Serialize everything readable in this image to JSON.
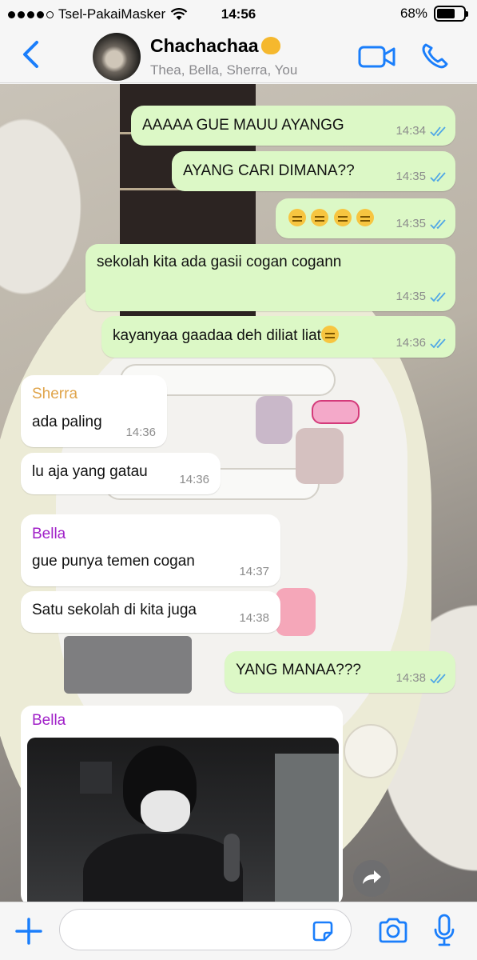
{
  "status_bar": {
    "carrier": "Tsel-PakaiMasker",
    "time": "14:56",
    "battery": "68%",
    "battery_level": 0.68
  },
  "header": {
    "title": "Chachachaa",
    "title_emoji": "cat-face-emoji",
    "members": "Thea, Bella, Sherra, You"
  },
  "messages": [
    {
      "dir": "out",
      "text": "AAAAA GUE MAUU AYANGG",
      "time": "14:34",
      "read": true
    },
    {
      "dir": "out",
      "text": "AYANG CARI DIMANA??",
      "time": "14:35",
      "read": true
    },
    {
      "dir": "out",
      "emoji": "pensive-face x4",
      "time": "14:35",
      "read": true
    },
    {
      "dir": "out",
      "text": "sekolah kita ada gasii cogan cogann",
      "time": "14:35",
      "read": true
    },
    {
      "dir": "out",
      "text": "kayanyaa gaadaa deh diliat liat",
      "emoji": "pensive-face",
      "time": "14:36",
      "read": true
    },
    {
      "dir": "in",
      "sender": "Sherra",
      "sender_color": "#e0a44a",
      "text": "ada paling",
      "time": "14:36"
    },
    {
      "dir": "in",
      "text": "lu aja yang gatau",
      "time": "14:36"
    },
    {
      "dir": "in",
      "sender": "Bella",
      "sender_color": "#a020c8",
      "text": "gue punya temen cogan",
      "time": "14:37"
    },
    {
      "dir": "in",
      "text": "Satu sekolah di kita juga",
      "time": "14:38"
    },
    {
      "dir": "out",
      "text": "YANG MANAA???",
      "time": "14:38",
      "read": true
    },
    {
      "dir": "in",
      "sender": "Bella",
      "sender_color": "#a020c8",
      "type": "photo"
    }
  ],
  "input": {
    "placeholder": ""
  },
  "colors": {
    "accent": "#1a7efb",
    "outgoing_bubble": "#dcf8c6",
    "incoming_bubble": "#ffffff",
    "read_ticks": "#4fa6e6"
  },
  "icons": {
    "back": "chevron-left-icon",
    "video": "video-camera-icon",
    "call": "phone-icon",
    "attach": "plus-icon",
    "sticker": "sticker-icon",
    "camera": "camera-icon",
    "mic": "microphone-icon",
    "forward": "forward-icon"
  }
}
